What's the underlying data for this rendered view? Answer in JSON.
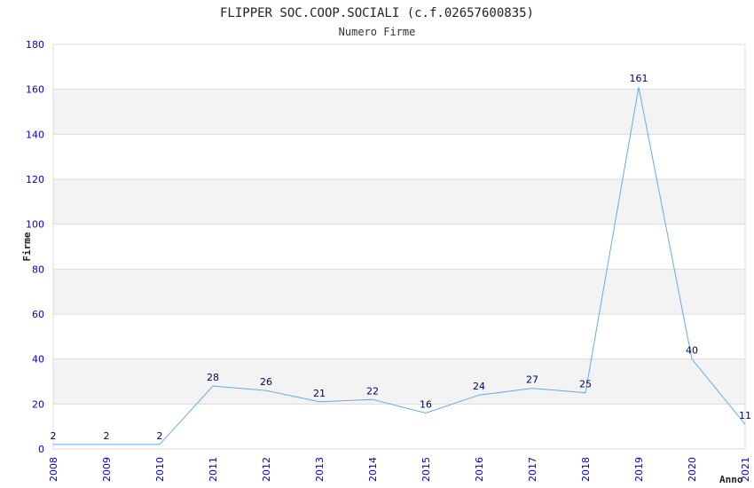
{
  "chart_data": {
    "type": "line",
    "title": "FLIPPER SOC.COOP.SOCIALI (c.f.02657600835)",
    "subtitle": "Numero Firme",
    "xlabel": "Anno",
    "ylabel": "Firme",
    "x": [
      "2008",
      "2009",
      "2010",
      "2011",
      "2012",
      "2013",
      "2014",
      "2015",
      "2016",
      "2017",
      "2018",
      "2019",
      "2020",
      "2021"
    ],
    "values": [
      2,
      2,
      2,
      28,
      26,
      21,
      22,
      16,
      24,
      27,
      25,
      161,
      40,
      11
    ],
    "ylim": [
      0,
      180
    ],
    "yticks": [
      0,
      20,
      40,
      60,
      80,
      100,
      120,
      140,
      160,
      180
    ],
    "grid": true,
    "alternating_bands": true,
    "colors": {
      "line": "#66aaee",
      "band": "#f3f3f3",
      "tick": "#0000cc",
      "label": "#000066"
    }
  }
}
